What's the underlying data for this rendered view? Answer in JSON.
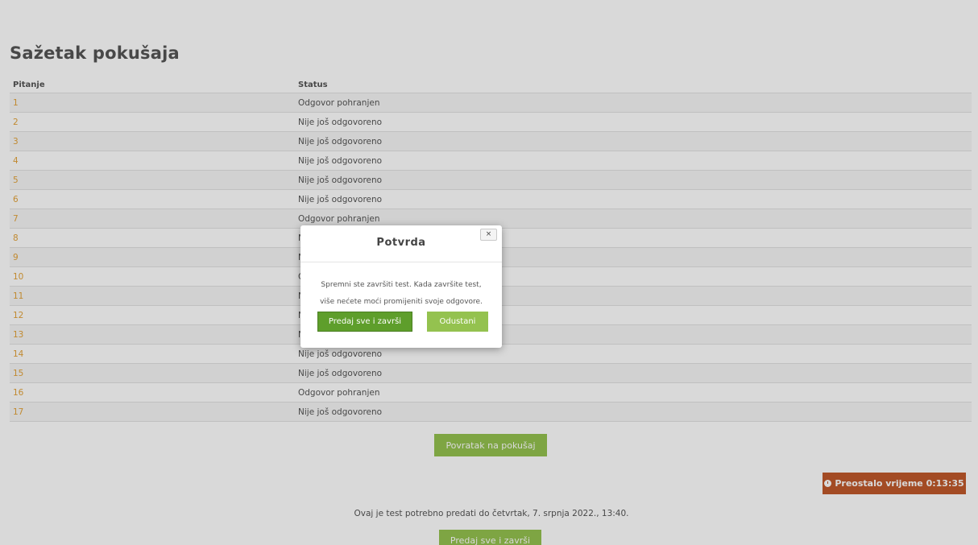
{
  "page": {
    "title": "Sažetak pokušaja",
    "columns": {
      "question": "Pitanje",
      "status": "Status"
    },
    "rows": [
      {
        "q": "1",
        "status": "Odgovor pohranjen"
      },
      {
        "q": "2",
        "status": "Nije još odgovoreno"
      },
      {
        "q": "3",
        "status": "Nije još odgovoreno"
      },
      {
        "q": "4",
        "status": "Nije još odgovoreno"
      },
      {
        "q": "5",
        "status": "Nije još odgovoreno"
      },
      {
        "q": "6",
        "status": "Nije još odgovoreno"
      },
      {
        "q": "7",
        "status": "Odgovor pohranjen"
      },
      {
        "q": "8",
        "status": "Nije još odgovoreno"
      },
      {
        "q": "9",
        "status": "Nije još odgovoreno"
      },
      {
        "q": "10",
        "status": "Odgovor pohranjen"
      },
      {
        "q": "11",
        "status": "Nije još odgovoreno"
      },
      {
        "q": "12",
        "status": "Nije još odgovoreno"
      },
      {
        "q": "13",
        "status": "Nije još odgovoreno"
      },
      {
        "q": "14",
        "status": "Nije još odgovoreno"
      },
      {
        "q": "15",
        "status": "Nije još odgovoreno"
      },
      {
        "q": "16",
        "status": "Odgovor pohranjen"
      },
      {
        "q": "17",
        "status": "Nije još odgovoreno"
      }
    ],
    "back_button": "Povratak na pokušaj",
    "timer": "Preostalo vrijeme 0:13:35",
    "deadline": "Ovaj je test potrebno predati do četvrtak, 7. srpnja 2022., 13:40.",
    "submit_button": "Predaj sve i završi"
  },
  "dialog": {
    "title": "Potvrda",
    "close": "×",
    "message_line1": "Spremni ste završiti test. Kada završite test,",
    "message_line2": "više nećete moći promijeniti svoje odgovore.",
    "confirm": "Predaj sve i završi",
    "cancel": "Odustani"
  },
  "colors": {
    "link": "#e3a33a",
    "button_green": "#94c24f",
    "button_dark_green": "#5e9e2b",
    "timer_bg": "#c0592b"
  }
}
